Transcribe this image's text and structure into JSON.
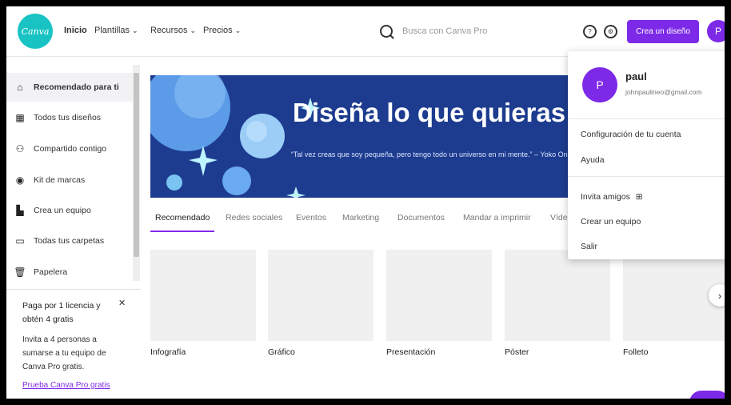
{
  "brand": {
    "logo_text": "Canva",
    "accent": "#7d2ae8",
    "logo_color": "#19c3c3"
  },
  "nav": {
    "items": [
      {
        "label": "Inicio"
      },
      {
        "label": "Plantillas",
        "chevron": "chevron-down-icon"
      },
      {
        "label": "Recursos",
        "chevron": "chevron-down-icon"
      },
      {
        "label": "Precios",
        "chevron": "chevron-down-icon"
      }
    ]
  },
  "search": {
    "placeholder": "Busca con Canva Pro",
    "icon": "search-icon"
  },
  "header": {
    "create_label": "Crea un diseño",
    "avatar_initial": "P",
    "icons": [
      "help-icon",
      "settings-icon"
    ]
  },
  "sidebar": {
    "items": [
      {
        "label": "Recomendado para ti",
        "icon": "home-icon",
        "active": true
      },
      {
        "label": "Todos tus diseños",
        "icon": "grid-icon"
      },
      {
        "label": "Compartido contigo",
        "icon": "people-icon"
      },
      {
        "label": "Kit de marcas",
        "icon": "brand-kit-icon"
      },
      {
        "label": "Crea un equipo",
        "icon": "team-icon"
      },
      {
        "label": "Todas tus carpetas",
        "icon": "folder-icon"
      },
      {
        "label": "Papelera",
        "icon": "trash-icon"
      }
    ],
    "promo": {
      "title": "Paga por 1 licencia y obtén 4 gratis",
      "body": "Invita a 4 personas a sumarse a tu equipo de Canva Pro gratis.",
      "link": "Prueba Canva Pro gratis"
    }
  },
  "banner": {
    "title": "Diseña lo que quieras",
    "quote": "“Tal vez creas que soy pequeña, pero tengo todo un universo en mi mente.” – Yoko Ono –"
  },
  "tabs": [
    {
      "label": "Recomendado",
      "active": true
    },
    {
      "label": "Redes sociales"
    },
    {
      "label": "Eventos"
    },
    {
      "label": "Marketing"
    },
    {
      "label": "Documentos"
    },
    {
      "label": "Mandar a imprimir"
    },
    {
      "label": "Vídeo"
    }
  ],
  "cards": [
    {
      "label": "Infografía"
    },
    {
      "label": "Gráfico"
    },
    {
      "label": "Presentación"
    },
    {
      "label": "Póster"
    },
    {
      "label": "Folleto"
    }
  ],
  "account_menu": {
    "initial": "P",
    "name": "paul",
    "email": "johnpaulineo@gmail.com",
    "items": [
      {
        "label": "Configuración de tu cuenta"
      },
      {
        "label": "Ayuda"
      },
      {
        "label": "Invita amigos",
        "icon": "gift-icon"
      },
      {
        "label": "Crear un equipo"
      },
      {
        "label": "Salir"
      }
    ]
  }
}
